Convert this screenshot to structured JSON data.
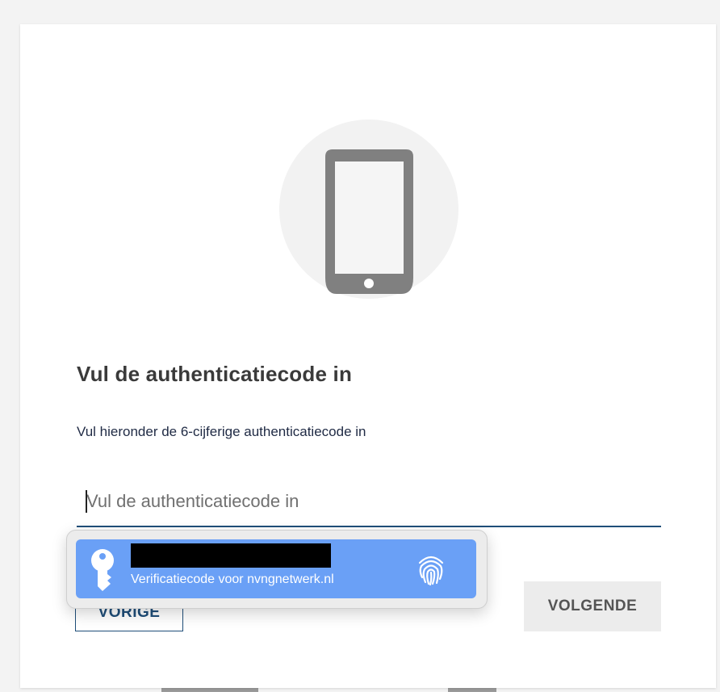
{
  "auth": {
    "title": "Vul de authenticatiecode in",
    "description": "Vul hieronder de 6-cijferige authenticatiecode in",
    "code_input": {
      "value": "",
      "placeholder": "Vul de authenticatiecode in"
    },
    "buttons": {
      "back_label": "VORIGE",
      "next_label": "VOLGENDE"
    },
    "illustration_icon": "smartphone-icon"
  },
  "autofill": {
    "subtitle": "Verificatiecode voor nvngnetwerk.nl",
    "leading_icon": "key-icon",
    "trailing_icon": "fingerprint-icon",
    "account_name_redacted": true
  },
  "colors": {
    "primary": "#1f4e79",
    "autofill_highlight": "#6aa0f6",
    "next_button_bg": "#ececec",
    "icon_grey": "#808080"
  }
}
